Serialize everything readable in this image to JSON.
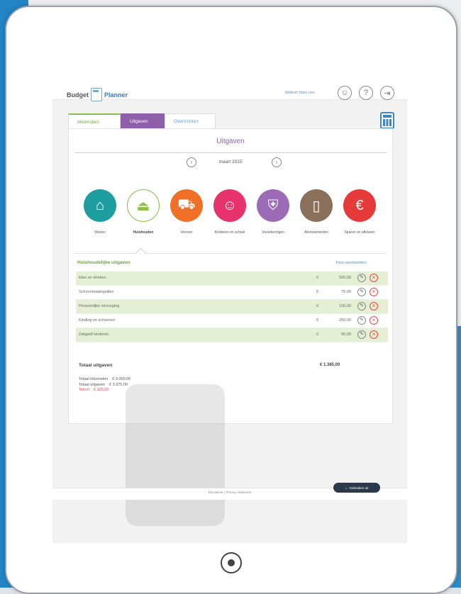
{
  "header": {
    "logo_part1": "Budget",
    "logo_part2": "Planner",
    "user_label": "Welkom Hans Lies"
  },
  "tabs": [
    {
      "label": "Inkomsten"
    },
    {
      "label": "Uitgaven"
    },
    {
      "label": "Overzichten"
    }
  ],
  "section": {
    "title": "Uitgaven",
    "month": "maart 2015"
  },
  "categories": [
    {
      "label": "Wonen",
      "color": "#1e9e9e",
      "icon": "house-icon"
    },
    {
      "label": "Huishouden",
      "color": "#ffffff",
      "icon": "iron-icon"
    },
    {
      "label": "Vervoer",
      "color": "#f07028",
      "icon": "car-icon"
    },
    {
      "label": "Kinderen en school",
      "color": "#e6336e",
      "icon": "pig-icon"
    },
    {
      "label": "Verzekeringen",
      "color": "#9b6bb5",
      "icon": "shield-icon"
    },
    {
      "label": "Abonnementen",
      "color": "#8a6f5a",
      "icon": "card-icon"
    },
    {
      "label": "Sparen en aflossen",
      "color": "#e63a3a",
      "icon": "euro-icon"
    }
  ],
  "list": {
    "title": "Huishoudelijke uitgaven",
    "link": "Toon voorbeelden",
    "rows": [
      {
        "name": "Eten en drinken",
        "currency": "€",
        "amount": "500,00"
      },
      {
        "name": "Schoonmaakspullen",
        "currency": "€",
        "amount": "75,00"
      },
      {
        "name": "Persoonlijke verzorging",
        "currency": "€",
        "amount": "100,00"
      },
      {
        "name": "Kleding en schoenen",
        "currency": "€",
        "amount": "250,00"
      },
      {
        "name": "Zakgeld kinderen",
        "currency": "€",
        "amount": "60,00"
      }
    ],
    "total_label": "Totaal uitgaven",
    "total_amount": "€ 1.385,00"
  },
  "summary": {
    "income_label": "Totaal inkomsten",
    "income_value": "€ 3.000,00",
    "expense_label": "Totaal uitgaven",
    "expense_value": "€ 3.375,00",
    "balance_label": "Tekort",
    "balance_value": "€ 125,00"
  },
  "footer": {
    "text": "Disclaimer | Privacy statement",
    "button": "Gebruiken uit"
  }
}
